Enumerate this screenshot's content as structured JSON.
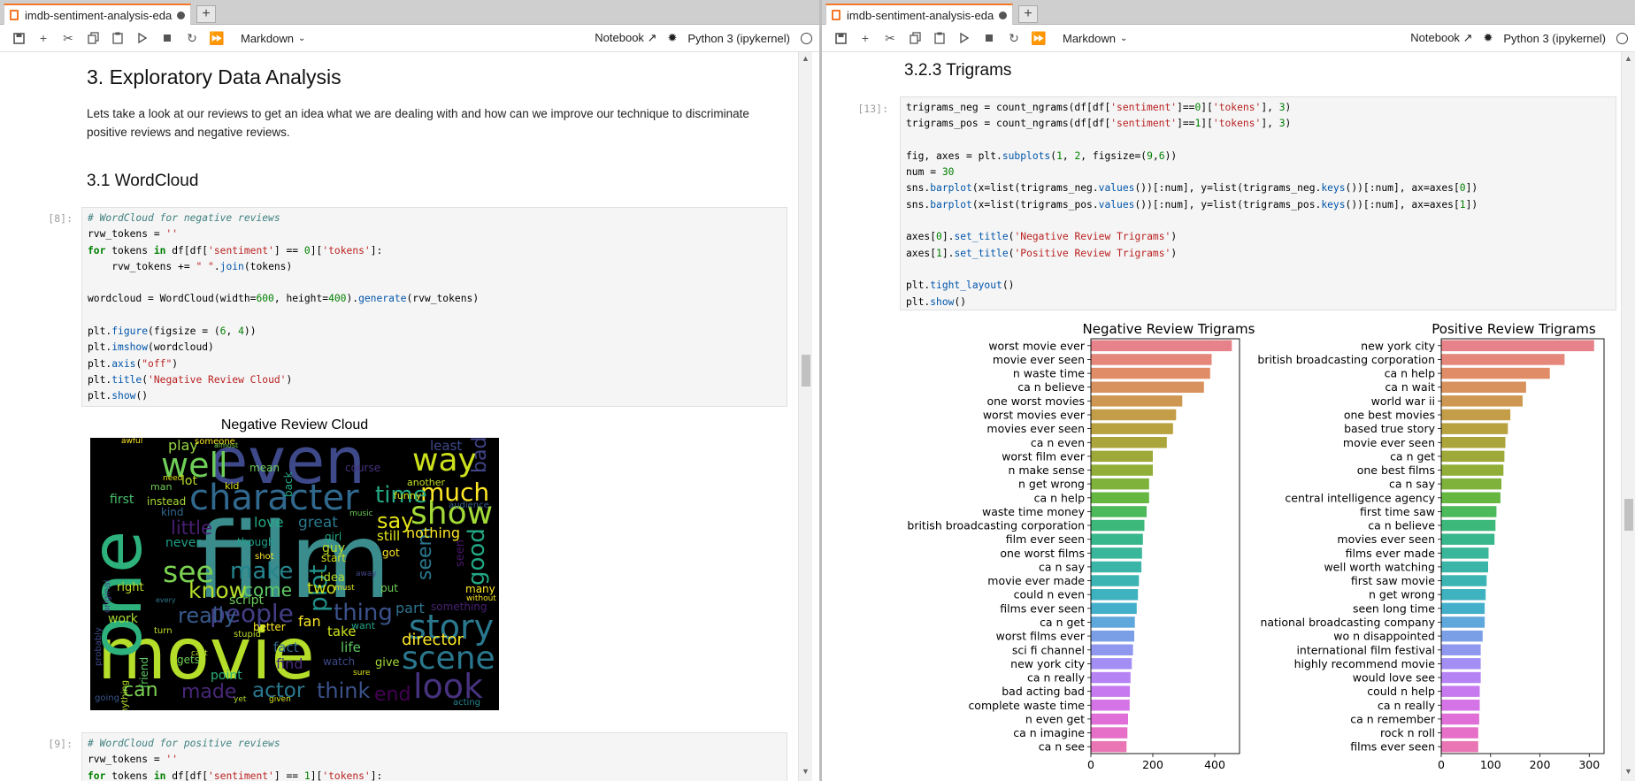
{
  "left": {
    "tab": {
      "title": "imdb-sentiment-analysis-eda"
    },
    "toolbar": {
      "cell_type": "Markdown",
      "notebook_label": "Notebook",
      "kernel": "Python 3 (ipykernel)"
    },
    "heading": "3. Exploratory Data Analysis",
    "paragraph": "Lets take a look at our reviews to get an idea what we are dealing with and how can we improve our technique to discriminate positive reviews and negative reviews.",
    "subheading": "3.1 WordCloud",
    "cell8": {
      "prompt": "[8]:",
      "lines": [
        "# WordCloud for negative reviews",
        "rvw_tokens = ''",
        "for tokens in df[df['sentiment'] == 0]['tokens']:",
        "    rvw_tokens += \" \".join(tokens)",
        "",
        "wordcloud = WordCloud(width=600, height=400).generate(rvw_tokens)",
        "",
        "plt.figure(figsize = (6, 4))",
        "plt.imshow(wordcloud)",
        "plt.axis(\"off\")",
        "plt.title('Negative Review Cloud')",
        "plt.show()"
      ]
    },
    "cloud_title": "Negative Review Cloud",
    "cloud_words": [
      {
        "t": "film",
        "c": "#3b8c8c"
      },
      {
        "t": "movie",
        "c": "#b5de2b"
      },
      {
        "t": "one",
        "c": "#2db27d"
      },
      {
        "t": "even",
        "c": "#3e4989"
      },
      {
        "t": "character",
        "c": "#31688e"
      },
      {
        "t": "well",
        "c": "#6ece58"
      },
      {
        "t": "way",
        "c": "#cde11d"
      },
      {
        "t": "show",
        "c": "#a2da37"
      },
      {
        "t": "story",
        "c": "#2a788e"
      },
      {
        "t": "scene",
        "c": "#2a788e"
      },
      {
        "t": "look",
        "c": "#46327e"
      },
      {
        "t": "see",
        "c": "#7ad151"
      },
      {
        "t": "make",
        "c": "#25858e"
      },
      {
        "t": "people",
        "c": "#433e85"
      },
      {
        "t": "much",
        "c": "#fde725"
      },
      {
        "t": "time",
        "c": "#22a884"
      },
      {
        "t": "say",
        "c": "#e5e419"
      },
      {
        "t": "know",
        "c": "#b5de2b"
      },
      {
        "t": "plot",
        "c": "#21918c"
      },
      {
        "t": "thing",
        "c": "#3b528b"
      },
      {
        "t": "really",
        "c": "#375a8c"
      },
      {
        "t": "actor",
        "c": "#2a788e"
      },
      {
        "t": "think",
        "c": "#3b528b"
      },
      {
        "t": "director",
        "c": "#fde725"
      },
      {
        "t": "little",
        "c": "#481f70"
      },
      {
        "t": "good",
        "c": "#22a884"
      },
      {
        "t": "made",
        "c": "#482878"
      },
      {
        "t": "can",
        "c": "#7ad151"
      },
      {
        "t": "end",
        "c": "#440154"
      },
      {
        "t": "seem",
        "c": "#2a788e"
      },
      {
        "t": "bad",
        "c": "#414487"
      },
      {
        "t": "come",
        "c": "#5ec962"
      },
      {
        "t": "two",
        "c": "#cde11d"
      },
      {
        "t": "part",
        "c": "#2c728e"
      },
      {
        "t": "nothing",
        "c": "#fde725"
      },
      {
        "t": "work",
        "c": "#a8db34"
      },
      {
        "t": "right",
        "c": "#bddf26"
      },
      {
        "t": "never",
        "c": "#1fa088"
      },
      {
        "t": "lot",
        "c": "#b8de29"
      },
      {
        "t": "love",
        "c": "#22a884"
      },
      {
        "t": "play",
        "c": "#95d840"
      },
      {
        "t": "great",
        "c": "#2a788e"
      },
      {
        "t": "first",
        "c": "#4ac16d"
      },
      {
        "t": "script",
        "c": "#6ccd5a"
      },
      {
        "t": "fan",
        "c": "#fde725"
      },
      {
        "t": "take",
        "c": "#cde11d"
      },
      {
        "t": "still",
        "c": "#e2e418"
      },
      {
        "t": "least",
        "c": "#3e4989"
      },
      {
        "t": "fact",
        "c": "#31688e"
      },
      {
        "t": "life",
        "c": "#5ec962"
      },
      {
        "t": "point",
        "c": "#2db27d"
      },
      {
        "t": "find",
        "c": "#472a7a"
      },
      {
        "t": "give",
        "c": "#a2da37"
      },
      {
        "t": "many",
        "c": "#fde725"
      },
      {
        "t": "idea",
        "c": "#b5de2b"
      },
      {
        "t": "guy",
        "c": "#b8de29"
      },
      {
        "t": "kind",
        "c": "#31688e"
      },
      {
        "t": "instead",
        "c": "#a8db34"
      },
      {
        "t": "mean",
        "c": "#6ece58"
      },
      {
        "t": "course",
        "c": "#46327e"
      },
      {
        "t": "another",
        "c": "#c2df23"
      },
      {
        "t": "acting",
        "c": "#25858e"
      },
      {
        "t": "want",
        "c": "#20a386"
      },
      {
        "t": "got",
        "c": "#fde725"
      },
      {
        "t": "girl",
        "c": "#22a884"
      },
      {
        "t": "start",
        "c": "#cde11d"
      },
      {
        "t": "funny",
        "c": "#dde318"
      },
      {
        "t": "gets",
        "c": "#70cf57"
      },
      {
        "t": "friend",
        "c": "#5ec962"
      },
      {
        "t": "watch",
        "c": "#3e4a89"
      },
      {
        "t": "man",
        "c": "#6ece58"
      },
      {
        "t": "kid",
        "c": "#dde318"
      },
      {
        "t": "better",
        "c": "#fde725"
      },
      {
        "t": "though",
        "c": "#1fa088"
      },
      {
        "t": "someone",
        "c": "#fde725"
      },
      {
        "t": "original",
        "c": "#414487"
      },
      {
        "t": "probably",
        "c": "#3e4989"
      },
      {
        "t": "anything",
        "c": "#b5de2b"
      },
      {
        "t": "audience",
        "c": "#355f8d"
      },
      {
        "t": "something",
        "c": "#482173"
      },
      {
        "t": "seen",
        "c": "#481668"
      },
      {
        "t": "put",
        "c": "#70cf57"
      },
      {
        "t": "shot",
        "c": "#fde725"
      },
      {
        "t": "yet",
        "c": "#b5de2b"
      },
      {
        "t": "music",
        "c": "#6ece58"
      },
      {
        "t": "stupid",
        "c": "#bddf26"
      },
      {
        "t": "given",
        "c": "#dde318"
      },
      {
        "t": "going",
        "c": "#38588c"
      },
      {
        "t": "back",
        "c": "#22a884"
      },
      {
        "t": "every",
        "c": "#2a788e"
      },
      {
        "t": "sure",
        "c": "#dde318"
      },
      {
        "t": "without",
        "c": "#fde725"
      },
      {
        "t": "must",
        "c": "#dde318"
      },
      {
        "t": "cast",
        "c": "#b5de2b"
      },
      {
        "t": "awful",
        "c": "#fde725"
      },
      {
        "t": "need",
        "c": "#dde318"
      },
      {
        "t": "almost",
        "c": "#7ad151"
      },
      {
        "t": "away",
        "c": "#414487"
      },
      {
        "t": "turn",
        "c": "#c2df23"
      }
    ],
    "cell9": {
      "prompt": "[9]:",
      "lines": [
        "# WordCloud for positive reviews",
        "rvw_tokens = ''",
        "for tokens in df[df['sentiment'] == 1]['tokens']:"
      ]
    }
  },
  "right": {
    "tab": {
      "title": "imdb-sentiment-analysis-eda"
    },
    "toolbar": {
      "cell_type": "Markdown",
      "notebook_label": "Notebook",
      "kernel": "Python 3 (ipykernel)"
    },
    "heading": "3.2.3 Trigrams",
    "cell13": {
      "prompt": "[13]:",
      "lines": [
        "trigrams_neg = count_ngrams(df[df['sentiment']==0]['tokens'], 3)",
        "trigrams_pos = count_ngrams(df[df['sentiment']==1]['tokens'], 3)",
        "",
        "fig, axes = plt.subplots(1, 2, figsize=(9,6))",
        "num = 30",
        "sns.barplot(x=list(trigrams_neg.values())[:num], y=list(trigrams_neg.keys())[:num], ax=axes[0])",
        "sns.barplot(x=list(trigrams_pos.values())[:num], y=list(trigrams_pos.keys())[:num], ax=axes[1])",
        "",
        "axes[0].set_title('Negative Review Trigrams')",
        "axes[1].set_title('Positive Review Trigrams')",
        "",
        "plt.tight_layout()",
        "plt.show()"
      ]
    }
  },
  "chart_data": [
    {
      "type": "bar",
      "orientation": "horizontal",
      "title": "Negative Review Trigrams",
      "categories": [
        "worst movie ever",
        "movie ever seen",
        "n waste time",
        "ca n believe",
        "one worst movies",
        "worst movies ever",
        "movies ever seen",
        "ca n even",
        "worst film ever",
        "n make sense",
        "n get wrong",
        "ca n help",
        "waste time money",
        "british broadcasting corporation",
        "film ever seen",
        "one worst films",
        "ca n say",
        "movie ever made",
        "could n even",
        "films ever seen",
        "ca n get",
        "worst films ever",
        "sci fi channel",
        "new york city",
        "ca n really",
        "bad acting bad",
        "complete waste time",
        "n even get",
        "ca n imagine",
        "ca n see"
      ],
      "values": [
        455,
        390,
        385,
        365,
        295,
        275,
        265,
        245,
        200,
        200,
        188,
        188,
        180,
        173,
        168,
        165,
        163,
        155,
        152,
        148,
        142,
        140,
        136,
        132,
        128,
        126,
        125,
        120,
        118,
        115
      ],
      "xlim": [
        0,
        480
      ],
      "xticks": [
        0,
        200,
        400
      ],
      "colors": [
        "#e8828a",
        "#e5877b",
        "#e08c67",
        "#d7925e",
        "#ce9852",
        "#c39d47",
        "#b8a13f",
        "#aca53b",
        "#9fa939",
        "#90ae38",
        "#7eb23a",
        "#65b741",
        "#4cb95a",
        "#3cb97a",
        "#39b78c",
        "#3ab79b",
        "#3bb5a8",
        "#3cb4b4",
        "#3eb2bf",
        "#44afcb",
        "#60a7dc",
        "#7b9fe6",
        "#9097ee",
        "#a38ef3",
        "#b583f3",
        "#c77af0",
        "#d574e6",
        "#e06fd8",
        "#e670c8",
        "#e975b5"
      ]
    },
    {
      "type": "bar",
      "orientation": "horizontal",
      "title": "Positive Review Trigrams",
      "categories": [
        "new york city",
        "british broadcasting corporation",
        "ca n help",
        "ca n wait",
        "world war ii",
        "one best movies",
        "based true story",
        "movie ever seen",
        "ca n get",
        "one best films",
        "ca n say",
        "central intelligence agency",
        "first time saw",
        "ca n believe",
        "movies ever seen",
        "films ever made",
        "well worth watching",
        "first saw movie",
        "n get wrong",
        "seen long time",
        "national broadcasting company",
        "wo n disappointed",
        "international film festival",
        "highly recommend movie",
        "would love see",
        "could n help",
        "ca n really",
        "ca n remember",
        "rock n roll",
        "films ever seen"
      ],
      "values": [
        310,
        250,
        220,
        172,
        165,
        140,
        135,
        130,
        128,
        126,
        122,
        120,
        112,
        110,
        108,
        96,
        95,
        92,
        90,
        88,
        88,
        84,
        80,
        80,
        80,
        78,
        78,
        77,
        75,
        75
      ],
      "xlim": [
        0,
        330
      ],
      "xticks": [
        0,
        100,
        200,
        300
      ],
      "colors": [
        "#e8828a",
        "#e5877b",
        "#e08c67",
        "#d7925e",
        "#ce9852",
        "#c39d47",
        "#b8a13f",
        "#aca53b",
        "#9fa939",
        "#90ae38",
        "#7eb23a",
        "#65b741",
        "#4cb95a",
        "#3cb97a",
        "#39b78c",
        "#3ab79b",
        "#3bb5a8",
        "#3cb4b4",
        "#3eb2bf",
        "#44afcb",
        "#60a7dc",
        "#7b9fe6",
        "#9097ee",
        "#a38ef3",
        "#b583f3",
        "#c77af0",
        "#d574e6",
        "#e06fd8",
        "#e670c8",
        "#e975b5"
      ]
    }
  ]
}
